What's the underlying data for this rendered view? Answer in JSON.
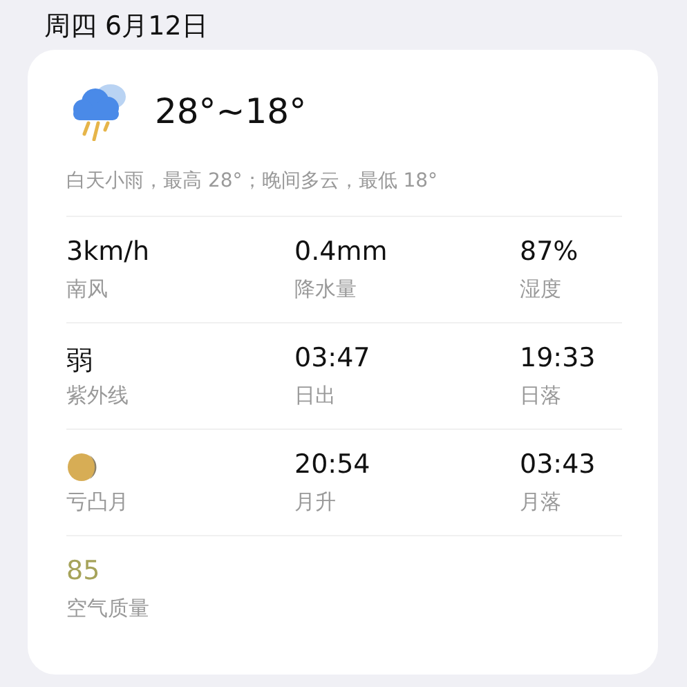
{
  "date": "周四 6月12日",
  "forecast": {
    "temperature": "28°~18°",
    "summary": "白天小雨，最高 28°；晚间多云，最低 18°"
  },
  "rows": [
    [
      {
        "kind": "text",
        "value": "3km/h",
        "label": "南风"
      },
      {
        "kind": "text",
        "value": "0.4mm",
        "label": "降水量"
      },
      {
        "kind": "text",
        "value": "87%",
        "label": "湿度"
      }
    ],
    [
      {
        "kind": "text",
        "value": "弱",
        "label": "紫外线"
      },
      {
        "kind": "text",
        "value": "03:47",
        "label": "日出"
      },
      {
        "kind": "text",
        "value": "19:33",
        "label": "日落"
      }
    ],
    [
      {
        "kind": "moon",
        "label": "亏凸月"
      },
      {
        "kind": "text",
        "value": "20:54",
        "label": "月升"
      },
      {
        "kind": "text",
        "value": "03:43",
        "label": "月落"
      }
    ],
    [
      {
        "kind": "aqi",
        "value": "85",
        "label": "空气质量"
      }
    ]
  ]
}
